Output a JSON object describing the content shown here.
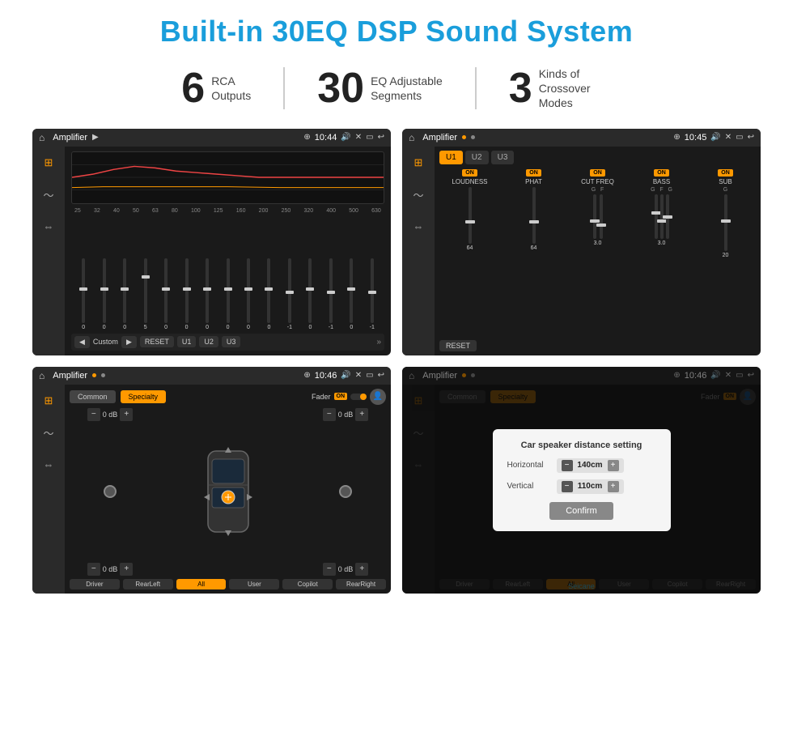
{
  "page": {
    "title": "Built-in 30EQ DSP Sound System",
    "stats": [
      {
        "number": "6",
        "desc": "RCA\nOutputs"
      },
      {
        "number": "30",
        "desc": "EQ Adjustable\nSegments"
      },
      {
        "number": "3",
        "desc": "Kinds of\nCrossover Modes"
      }
    ],
    "screens": [
      {
        "id": "screen1",
        "statusBar": {
          "title": "Amplifier",
          "time": "10:44"
        },
        "type": "eq"
      },
      {
        "id": "screen2",
        "statusBar": {
          "title": "Amplifier",
          "time": "10:45"
        },
        "type": "amp"
      },
      {
        "id": "screen3",
        "statusBar": {
          "title": "Amplifier",
          "time": "10:46"
        },
        "type": "common"
      },
      {
        "id": "screen4",
        "statusBar": {
          "title": "Amplifier",
          "time": "10:46"
        },
        "type": "dialog"
      }
    ],
    "eq": {
      "frequencies": [
        "25",
        "32",
        "40",
        "50",
        "63",
        "80",
        "100",
        "125",
        "160",
        "200",
        "250",
        "320",
        "400",
        "500",
        "630"
      ],
      "sliderValues": [
        "0",
        "0",
        "0",
        "5",
        "0",
        "0",
        "0",
        "0",
        "0",
        "0",
        "-1",
        "0",
        "-1"
      ],
      "bottomButtons": [
        "◀",
        "Custom",
        "▶",
        "RESET",
        "U1",
        "U2",
        "U3"
      ]
    },
    "amp": {
      "sections": [
        {
          "label": "LOUDNESS",
          "on": true,
          "sub": ""
        },
        {
          "label": "PHAT",
          "on": true,
          "sub": ""
        },
        {
          "label": "CUT FREQ",
          "on": true,
          "sub": "G  F"
        },
        {
          "label": "BASS",
          "on": true,
          "sub": "G  F  G"
        },
        {
          "label": "SUB",
          "on": true,
          "sub": "G"
        }
      ],
      "uButtons": [
        "U1",
        "U2",
        "U3"
      ],
      "resetLabel": "RESET"
    },
    "common": {
      "tabs": [
        "Common",
        "Specialty"
      ],
      "faderLabel": "Fader",
      "onLabel": "ON",
      "speakerValues": [
        "0 dB",
        "0 dB",
        "0 dB",
        "0 dB"
      ],
      "bottomButtons": [
        "Driver",
        "RearLeft",
        "All",
        "User",
        "Copilot",
        "RearRight"
      ]
    },
    "dialog": {
      "title": "Car speaker distance setting",
      "horizontalLabel": "Horizontal",
      "horizontalValue": "140cm",
      "verticalLabel": "Vertical",
      "verticalValue": "110cm",
      "confirmLabel": "Confirm"
    },
    "watermark": "Seicane"
  }
}
